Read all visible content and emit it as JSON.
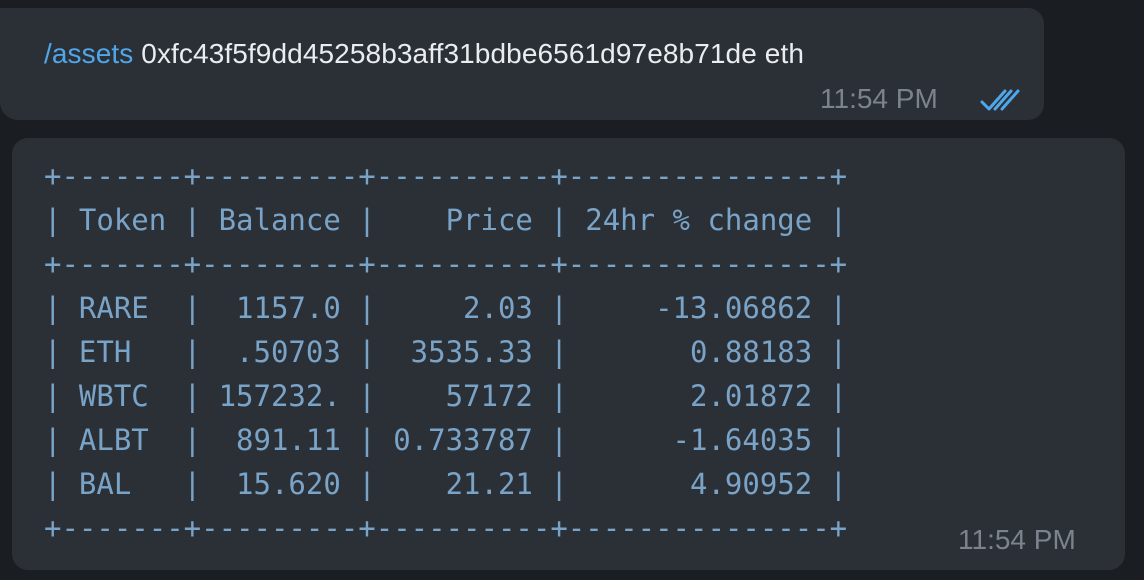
{
  "outgoing": {
    "command": "/assets",
    "argument": " 0xfc43f5f9dd45258b3aff31bdbe6561d97e8b71de eth",
    "time": "11:54 PM",
    "status_icon": "double-check-icon"
  },
  "incoming": {
    "table_lines": [
      "+-------+---------+----------+---------------+",
      "| Token | Balance |    Price | 24hr % change |",
      "+-------+---------+----------+---------------+",
      "| RARE  |  1157.0 |     2.03 |     -13.06862 |",
      "| ETH   |  .50703 |  3535.33 |       0.88183 |",
      "| WBTC  | 157232. |    57172 |       2.01872 |",
      "| ALBT  |  891.11 | 0.733787 |      -1.64035 |",
      "| BAL   |  15.620 |    21.21 |       4.90952 |",
      "+-------+---------+----------+---------------+"
    ],
    "time": "11:54 PM"
  },
  "colors": {
    "background": "#1a1e23",
    "bubble": "#2b3037",
    "link": "#4fa7ea",
    "table_text": "#7aa3c8",
    "meta": "#7b838c"
  }
}
